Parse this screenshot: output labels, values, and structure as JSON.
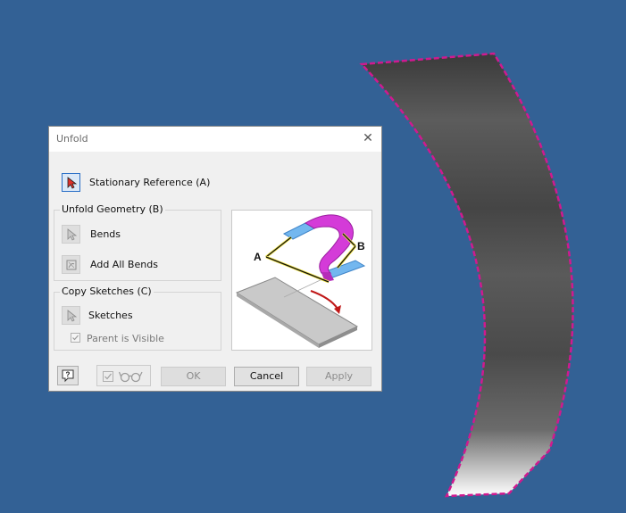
{
  "dialog": {
    "title": "Unfold",
    "stationary_reference_label": "Stationary Reference (A)",
    "unfold_geometry": {
      "legend": "Unfold Geometry (B)",
      "bends_label": "Bends",
      "add_all_bends_label": "Add All Bends"
    },
    "copy_sketches": {
      "legend": "Copy Sketches (C)",
      "sketches_label": "Sketches",
      "parent_visible_label": "Parent is Visible"
    },
    "preview": {
      "label_a": "A",
      "label_b": "B"
    },
    "buttons": {
      "ok": "OK",
      "cancel": "Cancel",
      "apply": "Apply"
    }
  },
  "icons": {
    "close": "close-icon",
    "select_arrow": "select-arrow-icon",
    "add_all_bends": "add-all-bends-icon",
    "help": "help-icon",
    "preview_glasses": "glasses-icon"
  },
  "colors": {
    "background": "#336195",
    "highlight": "#d0198f",
    "part_dark": "#3d3d3d"
  }
}
